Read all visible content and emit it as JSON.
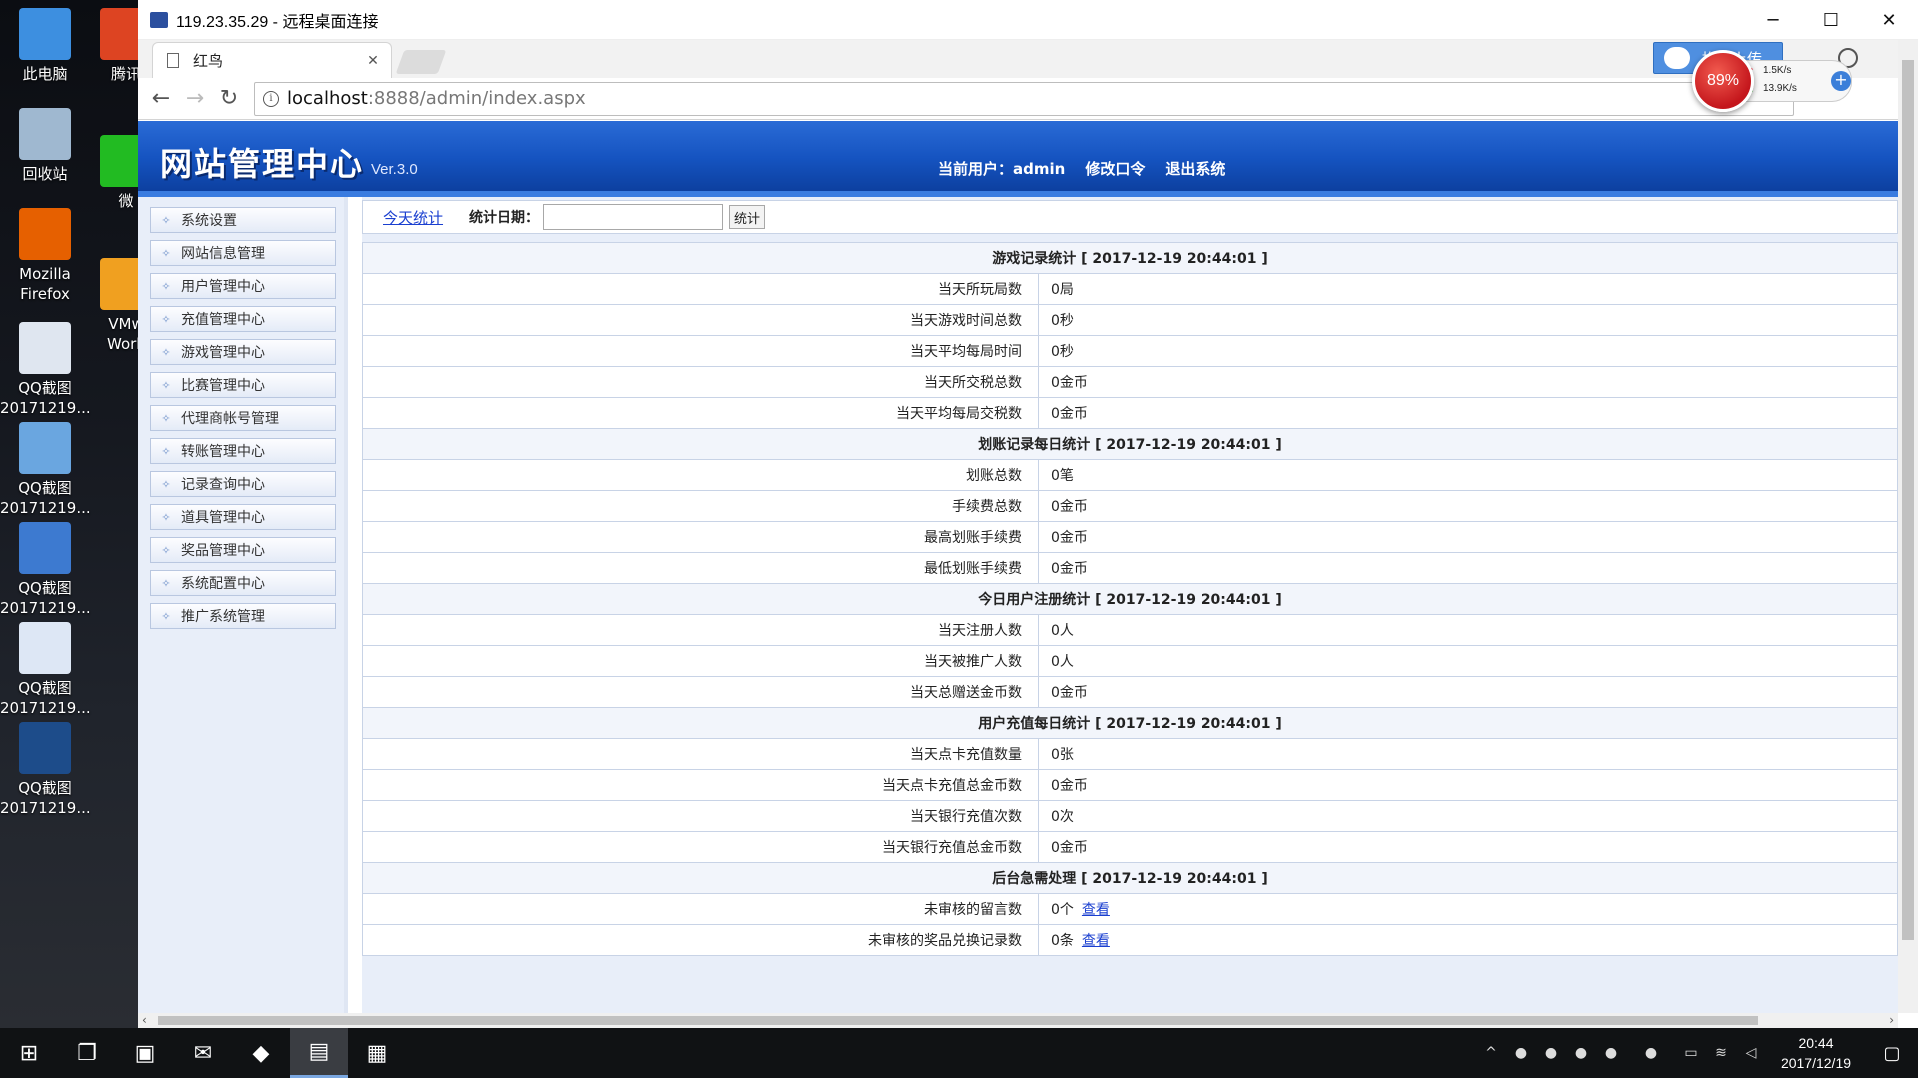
{
  "desktop": {
    "icons": [
      {
        "label": "此电脑",
        "color": "#3d8fe0"
      },
      {
        "label": "回收站",
        "color": "#9fb8d0"
      },
      {
        "label": "Mozilla Firefox",
        "color": "#e66000"
      },
      {
        "label": "QQ截图 20171219...",
        "color": "#dfe6f0"
      },
      {
        "label": "QQ截图 20171219...",
        "color": "#6aa6e0"
      },
      {
        "label": "QQ截图 20171219...",
        "color": "#3d7ad0"
      },
      {
        "label": "QQ截图 20171219...",
        "color": "#dde7f5"
      },
      {
        "label": "QQ截图 20171219...",
        "color": "#1d4c8a"
      }
    ],
    "icons_col2": [
      {
        "label": "腾讯",
        "color": "#d42"
      },
      {
        "label": "微",
        "color": "#2b2"
      },
      {
        "label": "VMw Work",
        "color": "#f0a020"
      }
    ]
  },
  "rdp": {
    "title": "119.23.35.29 - 远程桌面连接"
  },
  "browser": {
    "tab_title": "红鸟",
    "url_host": "localhost",
    "url_path": ":8888/admin/index.aspx",
    "upload_label": "拖拽上传",
    "speed": {
      "percent": "89%",
      "up": "1.5K/s",
      "down": "13.9K/s"
    }
  },
  "header": {
    "site_title": "网站管理中心",
    "version": "Ver.3.0",
    "current_user_label": "当前用户：",
    "current_user": "admin",
    "change_password": "修改口令",
    "logout": "退出系统"
  },
  "sidebar": {
    "items": [
      "系统设置",
      "网站信息管理",
      "用户管理中心",
      "充值管理中心",
      "游戏管理中心",
      "比赛管理中心",
      "代理商帐号管理",
      "转账管理中心",
      "记录查询中心",
      "道具管理中心",
      "奖品管理中心",
      "系统配置中心",
      "推广系统管理"
    ]
  },
  "toolbar": {
    "today_link": "今天统计",
    "date_label": "统计日期：",
    "date_value": "",
    "stat_button": "统计"
  },
  "stats": {
    "sections": [
      {
        "title": "游戏记录统计 [ 2017-12-19 20:44:01 ]",
        "rows": [
          {
            "label": "当天所玩局数",
            "value": "0局"
          },
          {
            "label": "当天游戏时间总数",
            "value": "0秒"
          },
          {
            "label": "当天平均每局时间",
            "value": "0秒"
          },
          {
            "label": "当天所交税总数",
            "value": "0金币"
          },
          {
            "label": "当天平均每局交税数",
            "value": "0金币"
          }
        ]
      },
      {
        "title": "划账记录每日统计 [ 2017-12-19 20:44:01 ]",
        "rows": [
          {
            "label": "划账总数",
            "value": "0笔"
          },
          {
            "label": "手续费总数",
            "value": "0金币"
          },
          {
            "label": "最高划账手续费",
            "value": "0金币"
          },
          {
            "label": "最低划账手续费",
            "value": "0金币"
          }
        ]
      },
      {
        "title": "今日用户注册统计 [ 2017-12-19 20:44:01 ]",
        "rows": [
          {
            "label": "当天注册人数",
            "value": "0人"
          },
          {
            "label": "当天被推广人数",
            "value": "0人"
          },
          {
            "label": "当天总赠送金币数",
            "value": "0金币"
          }
        ]
      },
      {
        "title": "用户充值每日统计 [ 2017-12-19 20:44:01 ]",
        "rows": [
          {
            "label": "当天点卡充值数量",
            "value": "0张"
          },
          {
            "label": "当天点卡充值总金币数",
            "value": "0金币"
          },
          {
            "label": "当天银行充值次数",
            "value": "0次"
          },
          {
            "label": "当天银行充值总金币数",
            "value": "0金币"
          }
        ]
      },
      {
        "title": "后台急需处理 [ 2017-12-19 20:44:01 ]",
        "rows": [
          {
            "label": "未审核的留言数",
            "value": "0个",
            "link": "查看"
          },
          {
            "label": "未审核的奖品兑换记录数",
            "value": "0条",
            "link": "查看"
          }
        ]
      }
    ]
  },
  "taskbar": {
    "clock_time": "20:44",
    "clock_date": "2017/12/19"
  }
}
